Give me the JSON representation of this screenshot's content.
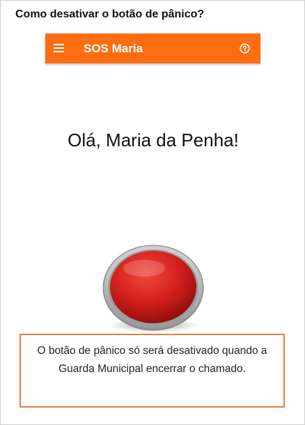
{
  "question": "Como desativar o botão de pânico?",
  "app_bar": {
    "title": "SOS Maria",
    "menu_icon": "hamburger-menu-icon",
    "help_icon": "help-circle-icon",
    "color": "#ff6d12"
  },
  "greeting": "Olá, Maria da Penha!",
  "panic_button": {
    "color": "#d4201c"
  },
  "callout": {
    "text": "O botão de pânico só será desativado quando a Guarda Municipal encerrar o chamado.",
    "border_color": "#ee7a3a"
  }
}
